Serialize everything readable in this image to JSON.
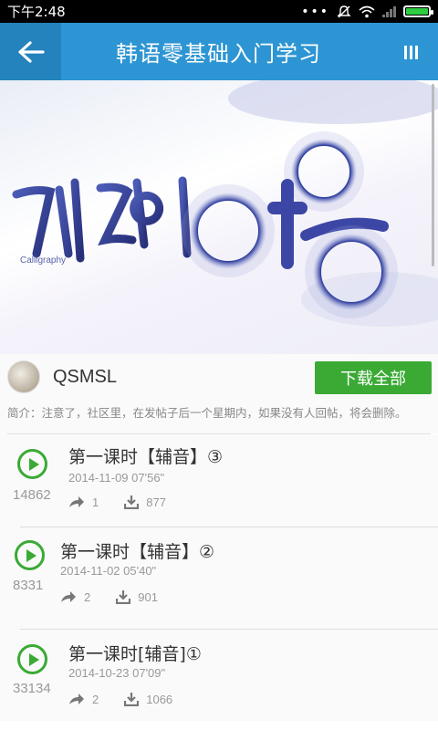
{
  "status_bar": {
    "time": "下午2:48",
    "dots": "•••"
  },
  "header": {
    "title": "韩语零基础入门学习",
    "back_icon": "arrow-left-icon",
    "menu_icon": "bars-icon"
  },
  "banner": {
    "calligraphy_text": "계절의 여름",
    "subtitle": "Calligraphy"
  },
  "author": {
    "name": "QSMSL",
    "download_all_label": "下载全部"
  },
  "intro": "简介：注意了，社区里，在发帖子后一个星期内，如果没有人回帖，将会删除。",
  "lessons": [
    {
      "title": "第一课时【辅音】③",
      "date": "2014-11-09  07'56\"",
      "plays": "14862",
      "shares": "1",
      "downloads": "877"
    },
    {
      "title": "第一课时【辅音】②",
      "date": "2014-11-02  05'40\"",
      "plays": "8331",
      "shares": "2",
      "downloads": "901"
    },
    {
      "title": "第一课时[辅音]①",
      "date": "2014-10-23  07'09\"",
      "plays": "33134",
      "shares": "2",
      "downloads": "1066"
    }
  ],
  "colors": {
    "header": "#2d95d3",
    "back_button_bg": "#2483bd",
    "accent_green": "#3aaa35"
  }
}
